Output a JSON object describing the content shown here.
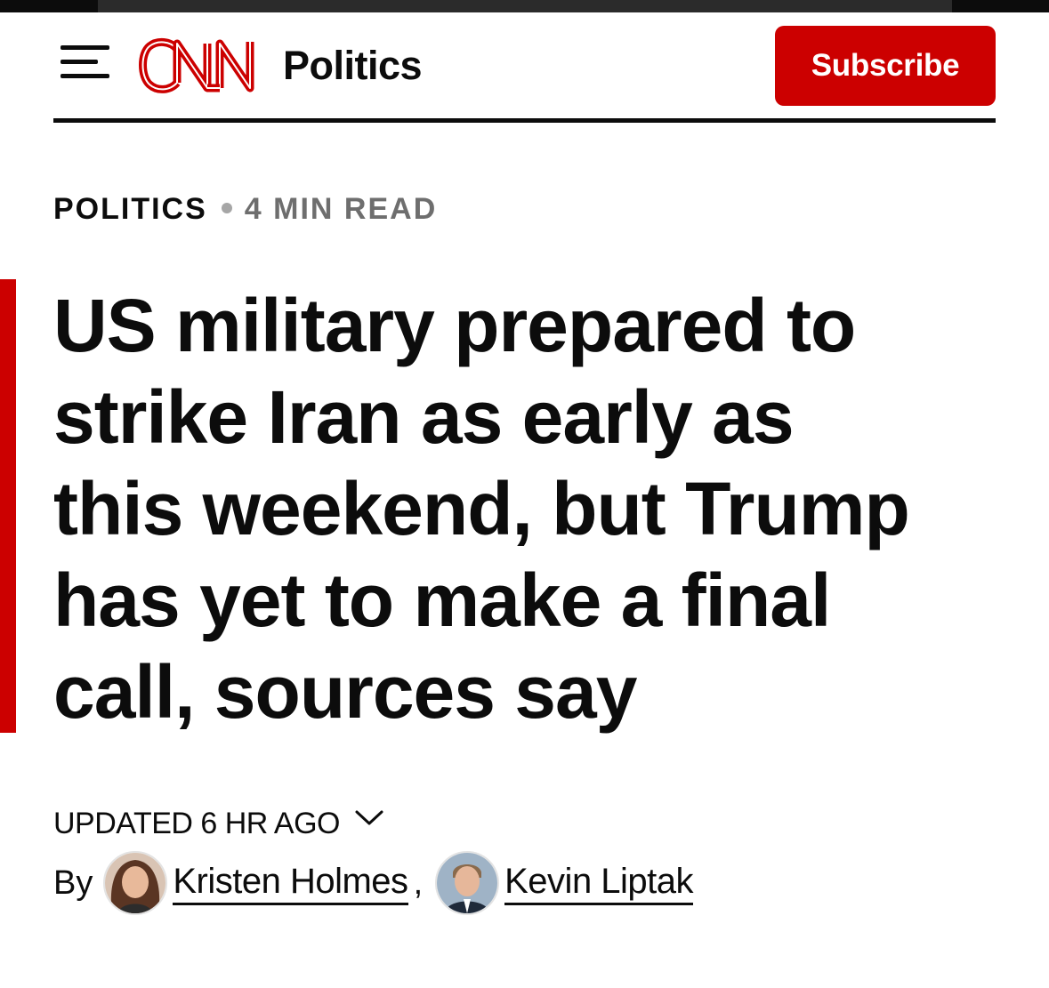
{
  "header": {
    "menu_icon": "hamburger-menu-icon",
    "logo_icon": "cnn-logo",
    "logo_text": "CNN",
    "section": "Politics",
    "subscribe_label": "Subscribe"
  },
  "meta": {
    "section": "POLITICS",
    "read_time": "4 MIN READ"
  },
  "article": {
    "headline": "US military prepared to\nstrike Iran as early as\nthis weekend, but Trump\nhas yet to make a final\ncall, sources say",
    "timestamp": "UPDATED 6 HR AGO",
    "byline_prefix": "By",
    "authors": [
      {
        "name": "Kristen Holmes"
      },
      {
        "name": "Kevin Liptak"
      }
    ],
    "author_separator": ","
  },
  "colors": {
    "brand_red": "#cc0000",
    "text": "#0c0c0c",
    "muted": "#6e6e6e"
  }
}
